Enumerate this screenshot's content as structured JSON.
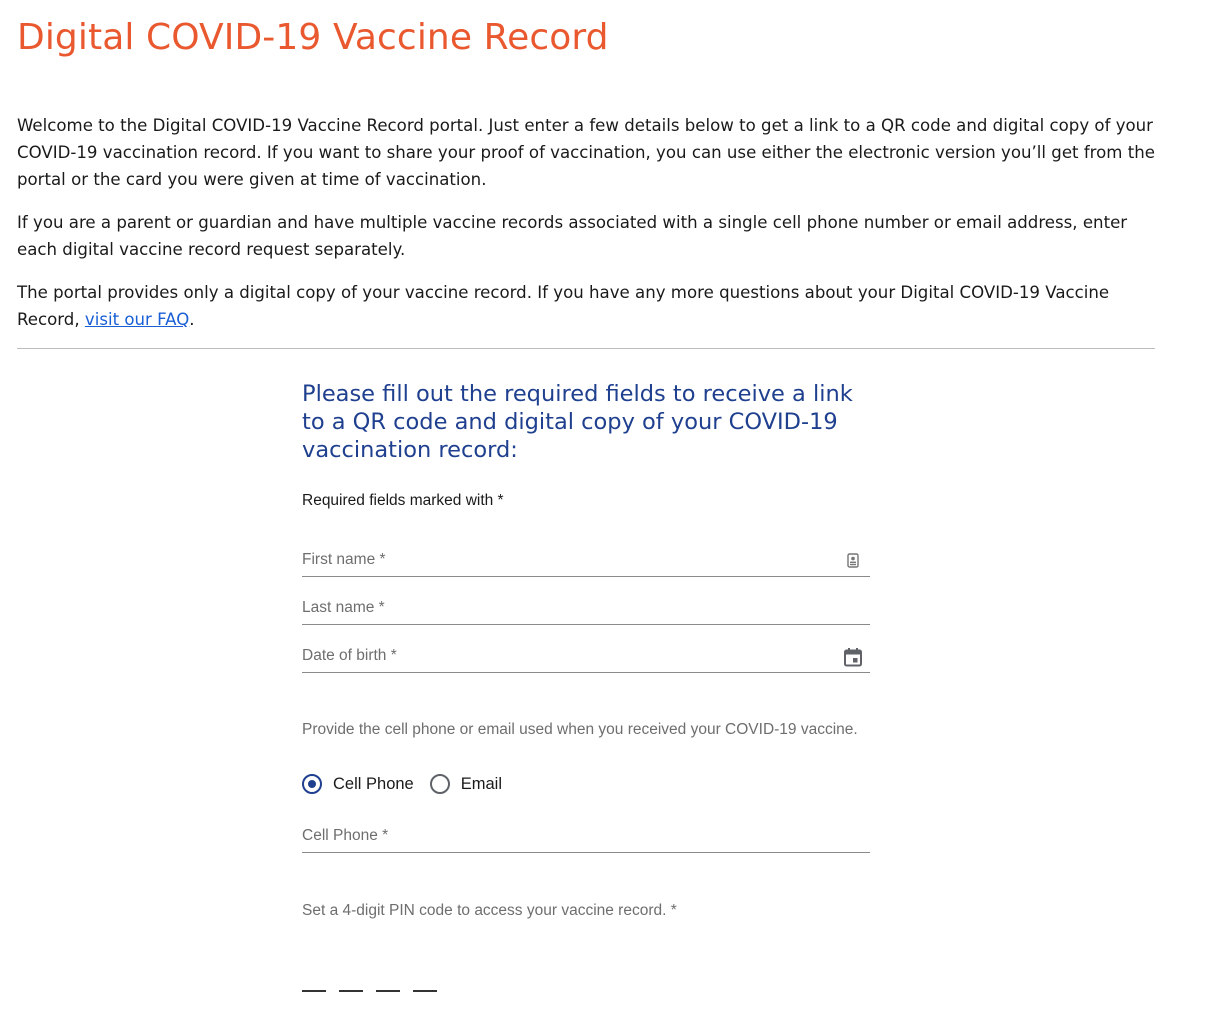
{
  "page": {
    "title": "Digital COVID-19 Vaccine Record",
    "title_color": "#e9582e"
  },
  "intro": {
    "p1": "Welcome to the Digital COVID-19 Vaccine Record portal. Just enter a few details below to get a link to a QR code and digital copy of your COVID-19 vaccination record. If you want to share your proof of vaccination, you can use either the electronic version you’ll get from the portal or the card you were given at time of vaccination.",
    "p2": "If you are a parent or guardian and have multiple vaccine records associated with a single cell phone number or email address, enter each digital vaccine record request separately.",
    "p3_text": "The portal provides only a digital copy of your vaccine record. If you have any more questions about your Digital COVID-19 Vaccine Record, ",
    "p3_link": "visit our FAQ",
    "p3_end": ".",
    "link_color": "#1a5fd6"
  },
  "form": {
    "heading": "Please fill out the required fields to receive a link to a QR code and digital copy of your COVID-19 vaccination record:",
    "heading_color": "#1f3f8f",
    "required_note": "Required fields marked with *",
    "first_name_label": "First name *",
    "first_name_icon": "contact-card-icon",
    "last_name_label": "Last name *",
    "dob_label": "Date of birth *",
    "dob_icon": "calendar-icon",
    "contact_helper": "Provide the cell phone or email used when you received your COVID-19 vaccine.",
    "contact_options": [
      {
        "label": "Cell Phone",
        "selected": true
      },
      {
        "label": "Email",
        "selected": false
      }
    ],
    "cell_phone_label": "Cell Phone *",
    "pin_label": "Set a 4-digit PIN code to access your vaccine record. *",
    "pin_digits": 4
  }
}
